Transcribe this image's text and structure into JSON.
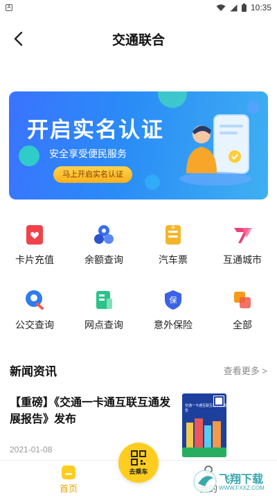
{
  "status_bar": {
    "left_badge": "A",
    "time": "10:35"
  },
  "header": {
    "title": "交通联合"
  },
  "banner": {
    "title": "开启实名认证",
    "subtitle": "安全享受便民服务",
    "button_label": "马上开启实名认证"
  },
  "services": [
    {
      "label": "卡片充值",
      "icon": "card-recharge-icon",
      "color": "#f0424a"
    },
    {
      "label": "余额查询",
      "icon": "balance-query-icon",
      "color": "#3a6cf0"
    },
    {
      "label": "汽车票",
      "icon": "bus-ticket-icon",
      "color": "#f5b52b"
    },
    {
      "label": "互通城市",
      "icon": "interconnect-city-icon",
      "color": "#f0407a"
    },
    {
      "label": "公交查询",
      "icon": "bus-query-icon",
      "color": "#2f7bf0"
    },
    {
      "label": "网点查询",
      "icon": "outlet-query-icon",
      "color": "#2cc28b"
    },
    {
      "label": "意外保险",
      "icon": "insurance-icon",
      "color": "#3c62e8"
    },
    {
      "label": "全部",
      "icon": "all-services-icon",
      "color": "#f59b1a"
    }
  ],
  "news": {
    "section_title": "新闻资讯",
    "more_label": "查看更多 >",
    "items": [
      {
        "headline": "【重磅】《交通一卡通互联互通发展报告》发布",
        "date": "2021-01-08",
        "thumb_text": "交通一卡通互联互通发展报告"
      }
    ]
  },
  "bottom_nav": {
    "home_label": "首页",
    "ride_label": "去乘车",
    "mine_label": "我的"
  },
  "watermark": {
    "text": "飞翔下载",
    "sub": "WWW.FXXZ.COM"
  },
  "colors": {
    "accent": "#ffcd1f",
    "banner_start": "#3a73ff",
    "banner_end": "#3fb0f2"
  }
}
